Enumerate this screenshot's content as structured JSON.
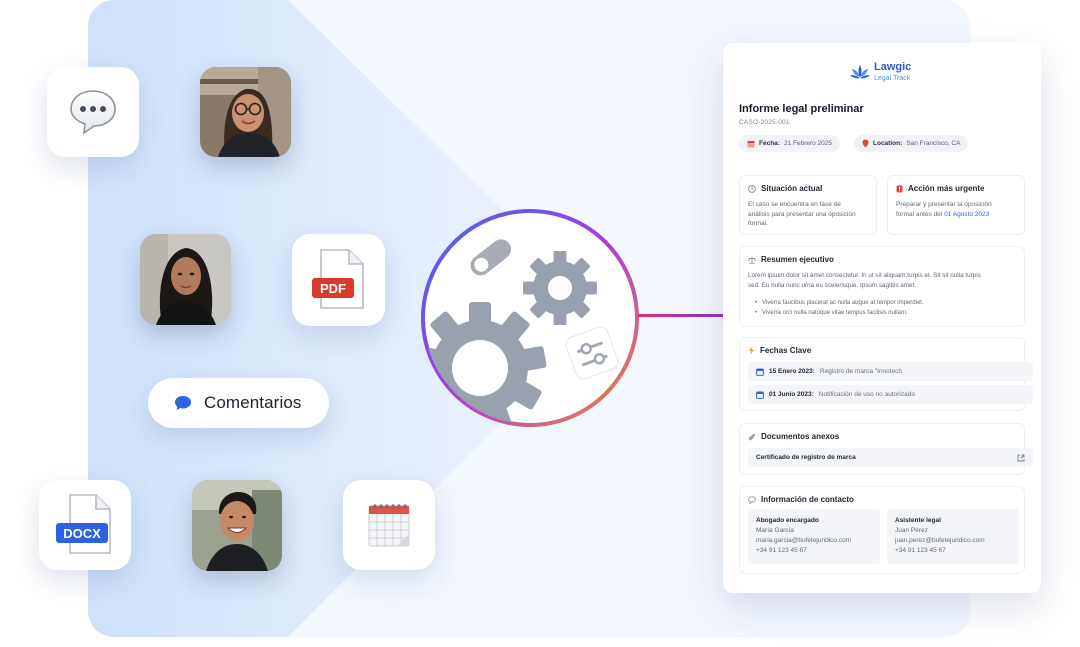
{
  "tiles": {
    "pdf_label": "PDF",
    "docx_label": "DOCX"
  },
  "pill": {
    "label": "Comentarios"
  },
  "brand": {
    "name": "Lawgic",
    "tagline": "Legal Track"
  },
  "report": {
    "title": "Informe legal preliminar",
    "case_id": "CASO-2025-001",
    "date_label": "Fecha:",
    "date_value": "21 Febrero 2025",
    "location_label": "Location:",
    "location_value": "San Francisco, CA"
  },
  "situation": {
    "title": "Situación actual",
    "lines": [
      "El caso se encuentra en fase de",
      "análisis para presentar una oposición",
      "formal."
    ]
  },
  "urgent": {
    "title": "Acción más urgente",
    "line1": "Preparar y presentar la oposición",
    "line2_prefix": "formal antes del ",
    "line2_date": "01 Agosto 2023"
  },
  "summary": {
    "title": "Resumen ejecutivo",
    "lines": [
      "Lorem ipsum dolor sit amet consectetur. In ut sit aliquam turpis et. Sit sit nulla turpis",
      "sed. Eu nulla nunc urna eu scelerisque. Ipsum sagittis amet."
    ],
    "bullets": [
      "Viverra faucibus placerat ac nulla augue at tempor imperdiet.",
      "Viverra orci nulla natoque vitae tempus facilisis nullam."
    ]
  },
  "key_dates": {
    "title": "Fechas Clave",
    "items": [
      {
        "date": "15 Enero 2023:",
        "desc": "Registro de marca \"Innotech"
      },
      {
        "date": "01 Junio 2023:",
        "desc": "Notificación de uso no autorizado"
      }
    ]
  },
  "documents": {
    "title": "Documentos anexos",
    "items": [
      {
        "name": "Certificado de registro de marca"
      }
    ]
  },
  "contact": {
    "title": "Información de contacto",
    "lawyer": {
      "role": "Abogado encargado",
      "name": "María García",
      "email": "maria.garcia@bufetejuridico.com",
      "phone": "+34 91 123 45 67"
    },
    "assistant": {
      "role": "Asistente legal",
      "name": "Juan Pérez",
      "email": "juan.perez@bufetejuridico.com",
      "phone": "+34 91 123 45 67"
    }
  },
  "colors": {
    "accent": "#2f63e0",
    "gradient_start": "#3a6cf0",
    "gradient_mid": "#a83be0",
    "gradient_end": "#f08a30",
    "gear": "#9aa1ae",
    "pdf_red": "#d93a2b",
    "docx_blue": "#2d63e2"
  }
}
